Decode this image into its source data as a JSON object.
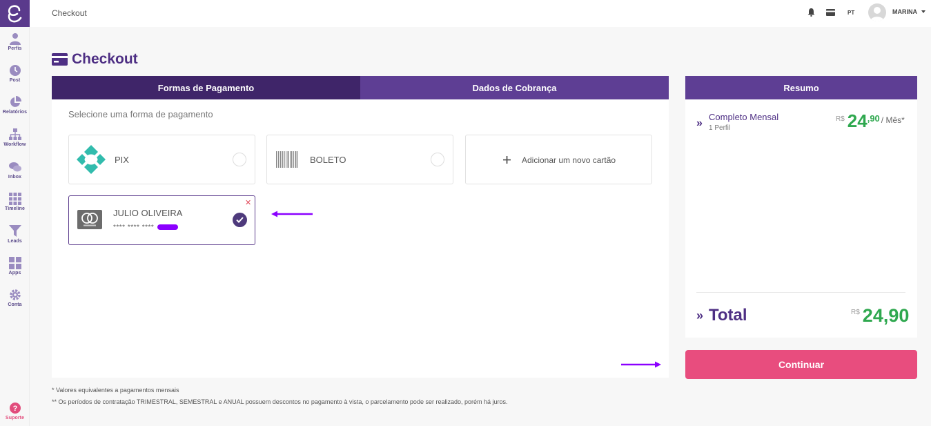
{
  "sidebar": {
    "items": [
      {
        "label": "Perfis",
        "icon": "user-icon"
      },
      {
        "label": "Post",
        "icon": "clock-icon"
      },
      {
        "label": "Relatórios",
        "icon": "pie-chart-icon"
      },
      {
        "label": "Workflow",
        "icon": "workflow-icon"
      },
      {
        "label": "Inbox",
        "icon": "chat-icon"
      },
      {
        "label": "Timeline",
        "icon": "grid-icon"
      },
      {
        "label": "Leads",
        "icon": "filter-icon"
      },
      {
        "label": "Apps",
        "icon": "apps-icon"
      },
      {
        "label": "Conta",
        "icon": "gear-icon"
      }
    ],
    "support_label": "Suporte"
  },
  "header": {
    "breadcrumb": "Checkout",
    "language": "PT",
    "user_name": "MARINA"
  },
  "page": {
    "title": "Checkout"
  },
  "tabs": [
    {
      "label": "Formas de Pagamento",
      "active": true
    },
    {
      "label": "Dados de Cobrança",
      "active": false
    }
  ],
  "payment": {
    "instruction": "Selecione uma forma de pagamento",
    "options": {
      "pix": "PIX",
      "boleto": "BOLETO",
      "new_card": "Adicionar um novo cartão"
    },
    "saved_card": {
      "holder": "JULIO OLIVEIRA",
      "number_masked": "**** **** ****",
      "brand": "mastercard",
      "selected": true
    }
  },
  "summary": {
    "header": "Resumo",
    "plan_name": "Completo Mensal",
    "plan_detail": "1 Perfil",
    "currency": "R$",
    "price_int": "24",
    "price_cents": ",90",
    "price_period": "/ Mês*",
    "total_label": "Total",
    "total_value": "24,90"
  },
  "actions": {
    "continue_label": "Continuar"
  },
  "footnotes": [
    "* Valores equivalentes a pagamentos mensais",
    "** Os períodos de contratação TRIMESTRAL, SEMESTRAL e ANUAL possuem descontos no pagamento à vista, o parcelamento pode ser realizado, porém há juros."
  ],
  "colors": {
    "brand_purple": "#5e3e94",
    "tab_active": "#3f2569",
    "price_green": "#2fa84f",
    "continue_pink": "#e84d7e",
    "annotation_arrow": "#8b00ff"
  }
}
